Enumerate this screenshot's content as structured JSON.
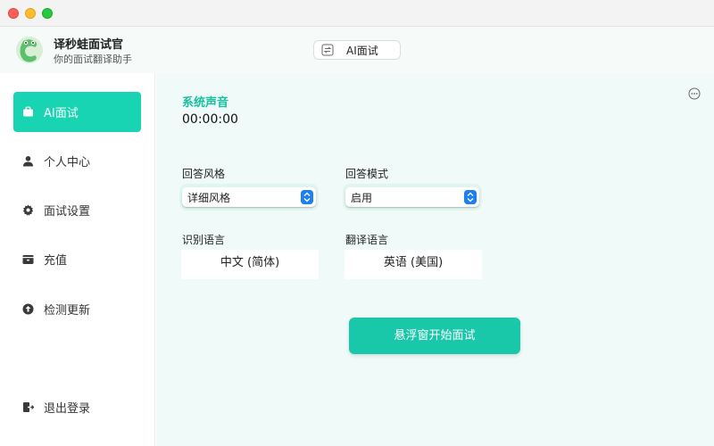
{
  "app": {
    "name": "译秒蛙面试官",
    "subtitle": "你的面试翻译助手",
    "mode_button_label": "AI面试"
  },
  "sidebar": {
    "items": [
      {
        "label": "AI面试",
        "icon": "briefcase-icon",
        "active": true
      },
      {
        "label": "个人中心",
        "icon": "person-icon",
        "active": false
      },
      {
        "label": "面试设置",
        "icon": "gear-icon",
        "active": false
      },
      {
        "label": "充值",
        "icon": "wallet-icon",
        "active": false
      },
      {
        "label": "检测更新",
        "icon": "arrow-up-circle-icon",
        "active": false
      }
    ],
    "logout": {
      "label": "退出登录",
      "icon": "logout-icon"
    }
  },
  "main": {
    "section_title": "系统声音",
    "timer": "00:00:00",
    "answer_style": {
      "label": "回答风格",
      "value": "详细风格"
    },
    "answer_mode": {
      "label": "回答模式",
      "value": "启用"
    },
    "recognition_language": {
      "label": "识别语言",
      "value": "中文 (简体)"
    },
    "translation_language": {
      "label": "翻译语言",
      "value": "英语 (美国)"
    },
    "start_button_label": "悬浮窗开始面试"
  },
  "colors": {
    "accent": "#19d4b3",
    "start_button": "#19c7a9",
    "section_title": "#17bfa0",
    "select_stepper": "#1e7ff0"
  }
}
